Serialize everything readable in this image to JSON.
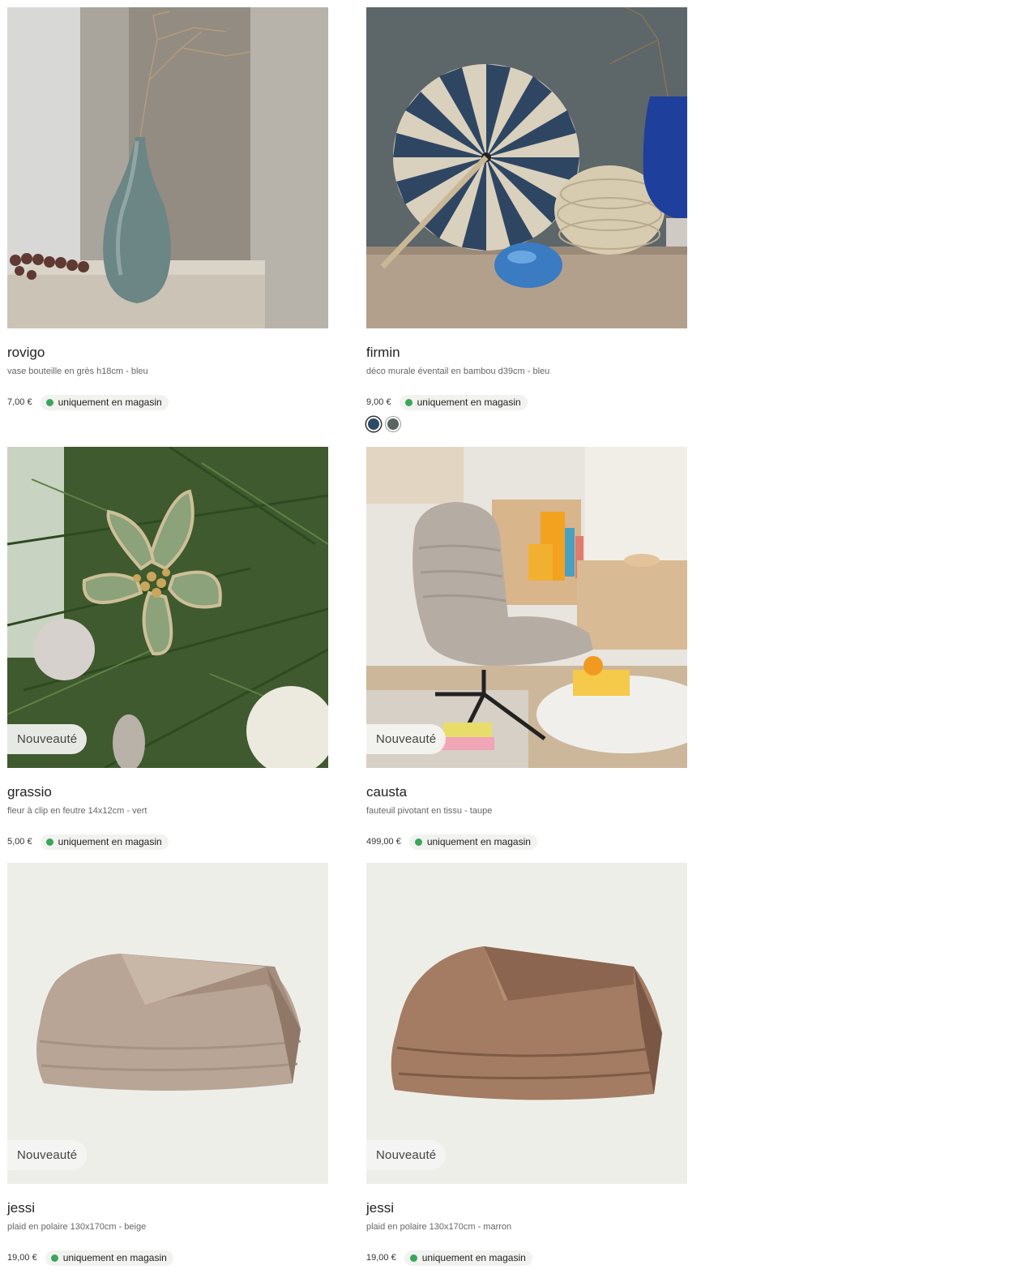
{
  "products": [
    {
      "name": "rovigo",
      "description": "vase bouteille en grès h18cm - bleu",
      "price": "7,00 €",
      "availability": "uniquement en magasin",
      "badge": "",
      "swatches": []
    },
    {
      "name": "firmin",
      "description": "déco murale éventail en bambou d39cm - bleu",
      "price": "9,00 €",
      "availability": "uniquement en magasin",
      "badge": "",
      "swatches": [
        "#2f4a66",
        "#5a6460"
      ]
    },
    {
      "name": "grassio",
      "description": "fleur à clip en feutre 14x12cm - vert",
      "price": "5,00 €",
      "availability": "uniquement en magasin",
      "badge": "Nouveauté",
      "swatches": []
    },
    {
      "name": "causta",
      "description": "fauteuil pivotant en tissu - taupe",
      "price": "499,00 €",
      "availability": "uniquement en magasin",
      "badge": "Nouveauté",
      "swatches": []
    },
    {
      "name": "jessi",
      "description": "plaid en polaire 130x170cm - beige",
      "price": "19,00 €",
      "availability": "uniquement en magasin",
      "badge": "Nouveauté",
      "swatches": []
    },
    {
      "name": "jessi",
      "description": "plaid en polaire 130x170cm - marron",
      "price": "19,00 €",
      "availability": "uniquement en magasin",
      "badge": "Nouveauté",
      "swatches": []
    }
  ],
  "colors": {
    "availability_dot": "#3aa65b",
    "badge_bg": "#f4f4f2"
  }
}
